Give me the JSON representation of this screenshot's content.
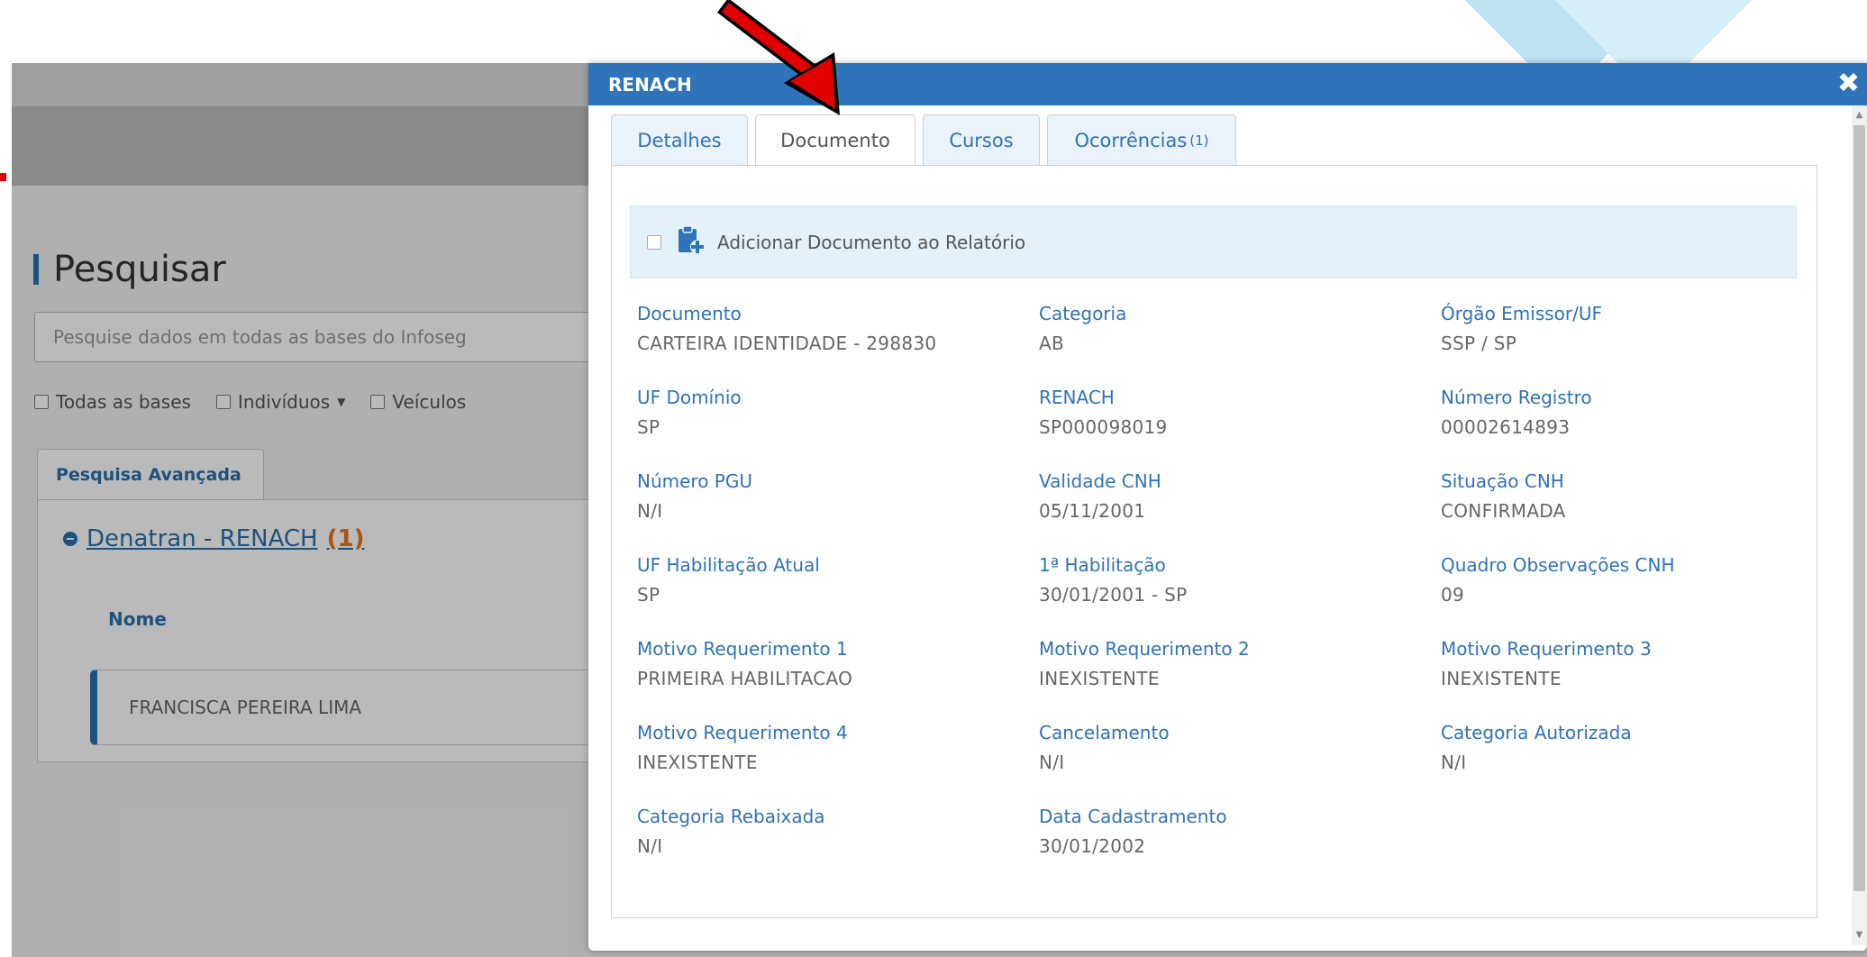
{
  "background": {
    "page_title": "Pesquisar",
    "search": {
      "placeholder": "Pesquise dados em todas as bases do Infoseg"
    },
    "base_options": [
      "Todas as bases",
      "Indivíduos",
      "Veículos"
    ],
    "advanced_tab": "Pesquisa Avançada",
    "group": {
      "title": "Denatran - RENACH",
      "count": "(1)"
    },
    "column_header": "Nome",
    "result_name": "FRANCISCA PEREIRA LIMA"
  },
  "modal": {
    "title": "RENACH",
    "close_icon": "close-icon",
    "tabs": [
      {
        "label": "Detalhes",
        "badge": ""
      },
      {
        "label": "Documento",
        "badge": ""
      },
      {
        "label": "Cursos",
        "badge": ""
      },
      {
        "label": "Ocorrências",
        "badge": "(1)"
      }
    ],
    "active_tab": "Documento",
    "report_label": "Adicionar Documento ao Relatório",
    "fields": [
      {
        "label": "Documento",
        "value": "CARTEIRA IDENTIDADE - 298830"
      },
      {
        "label": "Categoria",
        "value": "AB"
      },
      {
        "label": "Órgão Emissor/UF",
        "value": "SSP / SP"
      },
      {
        "label": "UF Domínio",
        "value": "SP"
      },
      {
        "label": "RENACH",
        "value": "SP000098019"
      },
      {
        "label": "Número Registro",
        "value": "00002614893"
      },
      {
        "label": "Número PGU",
        "value": "N/I"
      },
      {
        "label": "Validade CNH",
        "value": "05/11/2001"
      },
      {
        "label": "Situação CNH",
        "value": "CONFIRMADA"
      },
      {
        "label": "UF Habilitação Atual",
        "value": "SP"
      },
      {
        "label": "1ª Habilitação",
        "value": "30/01/2001 - SP"
      },
      {
        "label": "Quadro Observações CNH",
        "value": "09"
      },
      {
        "label": "Motivo Requerimento 1",
        "value": "PRIMEIRA HABILITACAO"
      },
      {
        "label": "Motivo Requerimento 2",
        "value": "INEXISTENTE"
      },
      {
        "label": "Motivo Requerimento 3",
        "value": "INEXISTENTE"
      },
      {
        "label": "Motivo Requerimento 4",
        "value": "INEXISTENTE"
      },
      {
        "label": "Cancelamento",
        "value": "N/I"
      },
      {
        "label": "Categoria Autorizada",
        "value": "N/I"
      },
      {
        "label": "Categoria Rebaixada",
        "value": "N/I"
      },
      {
        "label": "Data Cadastramento",
        "value": "30/01/2002"
      }
    ]
  },
  "colors": {
    "primary": "#2f73b8",
    "tab_inactive_bg": "#eaf3f9",
    "report_bar_bg": "#e4f1f9",
    "count_orange": "#e8731a",
    "arrow_red": "#e00000"
  }
}
